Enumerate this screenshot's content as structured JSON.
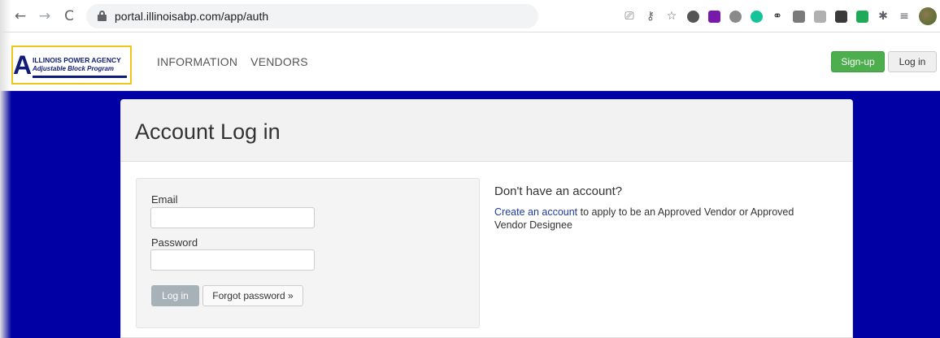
{
  "browser": {
    "url": "portal.illinoisabp.com/app/auth",
    "back_glyph": "←",
    "forward_glyph": "→",
    "reload_glyph": "C",
    "extension_icons": [
      {
        "name": "cast-icon",
        "glyph": "⎚",
        "color": "#5f6368"
      },
      {
        "name": "key-icon",
        "glyph": "⚷",
        "color": "#5f6368"
      },
      {
        "name": "star-icon",
        "glyph": "☆",
        "color": "#5f6368"
      },
      {
        "name": "circle-ext-icon",
        "glyph": "",
        "color": "#555555"
      },
      {
        "name": "onenote-icon",
        "glyph": "",
        "color": "#7719aa"
      },
      {
        "name": "ublock-icon",
        "glyph": "",
        "color": "#8a8a8a"
      },
      {
        "name": "grammarly-icon",
        "glyph": "",
        "color": "#15c39a"
      },
      {
        "name": "link-ext-icon",
        "glyph": "⚭",
        "color": "#333333"
      },
      {
        "name": "screen-ext-icon",
        "glyph": "",
        "color": "#7a7a7a"
      },
      {
        "name": "gray-ext-icon",
        "glyph": "",
        "color": "#b0b0b0"
      },
      {
        "name": "dark-ext-icon",
        "glyph": "",
        "color": "#3a3a3a"
      },
      {
        "name": "green-ext-icon",
        "glyph": "",
        "color": "#1faa59"
      },
      {
        "name": "puzzle-icon",
        "glyph": "✱",
        "color": "#5f6368"
      },
      {
        "name": "media-icon",
        "glyph": "≡",
        "color": "#5f6368"
      }
    ]
  },
  "header": {
    "logo": {
      "letter": "A",
      "line1": "ILLINOIS POWER AGENCY",
      "line2": "Adjustable Block Program"
    },
    "nav": [
      "INFORMATION",
      "VENDORS"
    ],
    "signup_label": "Sign-up",
    "login_label": "Log in"
  },
  "panel": {
    "title": "Account Log in",
    "form": {
      "email_label": "Email",
      "email_value": "",
      "password_label": "Password",
      "password_value": "",
      "login_button": "Log in",
      "forgot_button": "Forgot password »"
    },
    "side": {
      "heading": "Don't have an account?",
      "link_text": "Create an account",
      "rest_text": " to apply to be an Approved Vendor or Approved Vendor Designee"
    }
  },
  "colors": {
    "band": "#0000a4",
    "signup": "#4cae4c",
    "brand_navy": "#0f1b7a",
    "logo_border": "#f0c419"
  }
}
